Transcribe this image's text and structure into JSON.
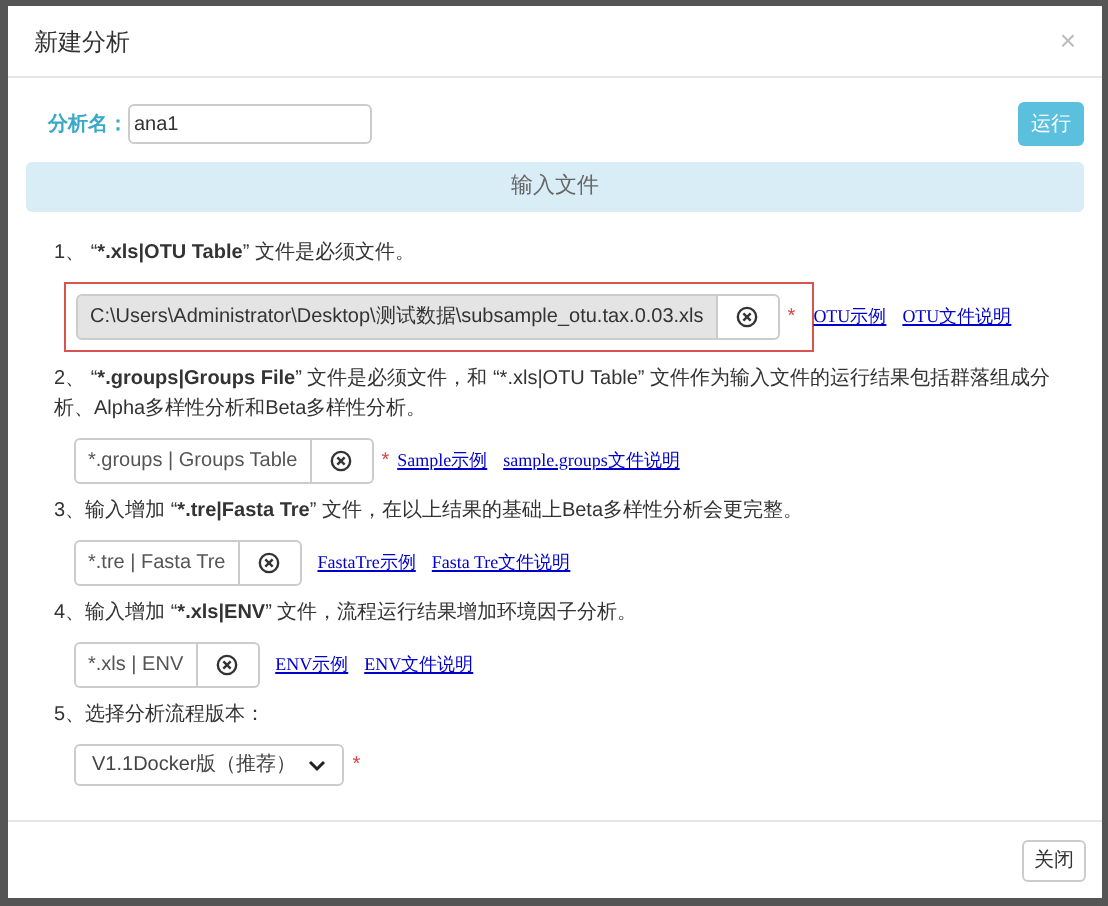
{
  "dialog": {
    "title": "新建分析",
    "close_icon": "×"
  },
  "name_field": {
    "label": "分析名：",
    "value": "ana1"
  },
  "run_button": "运行",
  "section_header": "输入文件",
  "steps": [
    {
      "kind": "file",
      "text_parts": [
        {
          "text": "1、 “",
          "bold": false
        },
        {
          "text": "*.xls|OTU Table",
          "bold": true
        },
        {
          "text": "” 文件是必须文件。",
          "bold": false
        }
      ],
      "value": "C:\\Users\\Administrator\\Desktop\\测试数据\\subsample_otu.tax.0.03.xls",
      "filled": true,
      "required_mark": "*",
      "highlighted": true,
      "links": [
        "OTU示例",
        "OTU文件说明"
      ]
    },
    {
      "kind": "file",
      "text_parts": [
        {
          "text": "2、 “",
          "bold": false
        },
        {
          "text": "*.groups|Groups File",
          "bold": true
        },
        {
          "text": "” 文件是必须文件，和 “*.xls|OTU Table” 文件作为输入文件的运行结果包括群落组成分析、Alpha多样性分析和Beta多样性分析。",
          "bold": false
        }
      ],
      "value": "*.groups | Groups Table",
      "filled": false,
      "required_mark": "*",
      "highlighted": false,
      "links": [
        "Sample示例",
        "sample.groups文件说明"
      ]
    },
    {
      "kind": "file",
      "text_parts": [
        {
          "text": "3、输入增加 “",
          "bold": false
        },
        {
          "text": "*.tre|Fasta Tre",
          "bold": true
        },
        {
          "text": "” 文件，在以上结果的基础上Beta多样性分析会更完整。",
          "bold": false
        }
      ],
      "value": "*.tre | Fasta Tre",
      "filled": false,
      "highlighted": false,
      "links": [
        "FastaTre示例",
        "Fasta Tre文件说明"
      ]
    },
    {
      "kind": "file",
      "text_parts": [
        {
          "text": "4、输入增加 “",
          "bold": false
        },
        {
          "text": "*.xls|ENV",
          "bold": true
        },
        {
          "text": "” 文件，流程运行结果增加环境因子分析。",
          "bold": false
        }
      ],
      "value": "*.xls | ENV",
      "filled": false,
      "highlighted": false,
      "links": [
        "ENV示例",
        "ENV文件说明"
      ]
    },
    {
      "kind": "select",
      "text_parts": [
        {
          "text": "5、选择分析流程版本：",
          "bold": false
        }
      ],
      "value": "V1.1Docker版（推荐）",
      "required_mark": "*"
    }
  ],
  "footer_button": "关闭"
}
